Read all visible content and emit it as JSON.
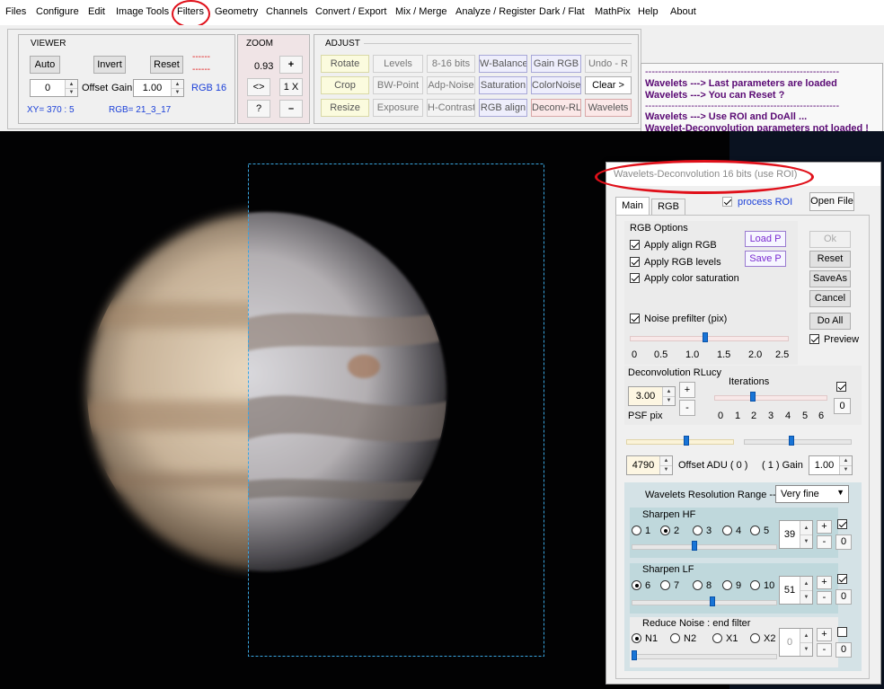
{
  "menu": [
    "Files",
    "Configure",
    "Edit",
    "Image Tools",
    "Filters",
    "Geometry",
    "Channels",
    "Convert / Export",
    "Mix / Merge",
    "Analyze / Register",
    "Dark / Flat",
    "MathPix",
    "Help",
    "About"
  ],
  "viewer": {
    "title": "VIEWER",
    "auto": "Auto",
    "invert": "Invert",
    "reset": "Reset",
    "dashes1": "------",
    "dashes2": "------",
    "offset_value": "0",
    "offset_label": "Offset",
    "gain_label": "Gain",
    "gain_value": "1.00",
    "rgb_mode": "RGB 16",
    "xy": "XY=  370 : 5",
    "rgb": "RGB=  21_3_17"
  },
  "zoom": {
    "title": "ZOOM",
    "value": "0.93",
    "plus": "+",
    "fit": "<>",
    "one_x": "1 X",
    "help": "?",
    "minus": "–"
  },
  "adjust": {
    "title": "ADJUST",
    "buttons": [
      [
        "Rotate",
        "Levels",
        "8-16 bits",
        "W-Balance",
        "Gain RGB",
        "Undo - R"
      ],
      [
        "Crop",
        "BW-Point",
        "Adp-Noise",
        "Saturation",
        "ColorNoise",
        "Clear >"
      ],
      [
        "Resize",
        "Exposure",
        "H-Contrast",
        "RGB align",
        "Deconv-RL",
        "Wavelets"
      ]
    ]
  },
  "messages": {
    "sep1": "-----------------------------------------------------------",
    "l1": "Wavelets   --->  Last parameters are loaded",
    "l2": "Wavelets   --->  You can Reset ?",
    "sep2": "-----------------------------------------------------------",
    "l3": "Wavelets   --->  Use ROI and DoAll ...",
    "l4": "Wavelet-Deconvolution parameters not loaded !"
  },
  "dialog": {
    "title": "Wavelets-Deconvolution 16 bits (use ROI)",
    "tab_main": "Main",
    "tab_rgb": "RGB",
    "process_roi": "process ROI",
    "open_file": "Open File",
    "rgb_options": "RGB Options",
    "apply_align": "Apply align RGB",
    "apply_levels": "Apply RGB levels",
    "apply_saturation": "Apply color saturation",
    "load_p": "Load P",
    "save_p": "Save P",
    "ok": "Ok",
    "reset": "Reset",
    "saveas": "SaveAs",
    "cancel": "Cancel",
    "do_all": "Do All",
    "preview": "Preview",
    "noise_prefilter": "Noise prefilter (pix)",
    "noise_scale": [
      "0",
      "0.5",
      "1.0",
      "1.5",
      "2.0",
      "2.5"
    ],
    "noise_value": 1.25,
    "deconv_title": "Deconvolution RLucy",
    "psf_value": "3.00",
    "psf_label": "PSF pix",
    "plus": "+",
    "minus": "-",
    "iterations_label": "Iterations",
    "iter_scale": [
      "0",
      "1",
      "2",
      "3",
      "4",
      "5",
      "6"
    ],
    "iter_value": 2,
    "iter_zero": "0",
    "offset_value": "4790",
    "offset_label": "Offset ADU ( 0 )",
    "gain_label": "( 1 )  Gain",
    "gain_value": "1.00",
    "wavelets_range_label": "Wavelets Resolution Range  -->",
    "wavelets_range_value": "Very fine",
    "sharpen_hf": {
      "title": "Sharpen HF",
      "options": [
        "1",
        "2",
        "3",
        "4",
        "5"
      ],
      "selected": "2",
      "value": "39",
      "level": 0.44
    },
    "sharpen_lf": {
      "title": "Sharpen LF",
      "options": [
        "6",
        "7",
        "8",
        "9",
        "10"
      ],
      "selected": "6",
      "value": "51",
      "level": 0.56
    },
    "reduce_noise": {
      "title": "Reduce Noise : end filter",
      "options": [
        "N1",
        "N2",
        "X1",
        "X2"
      ],
      "selected": "N1",
      "value": "0",
      "level": 0.0
    },
    "zero": "0"
  }
}
